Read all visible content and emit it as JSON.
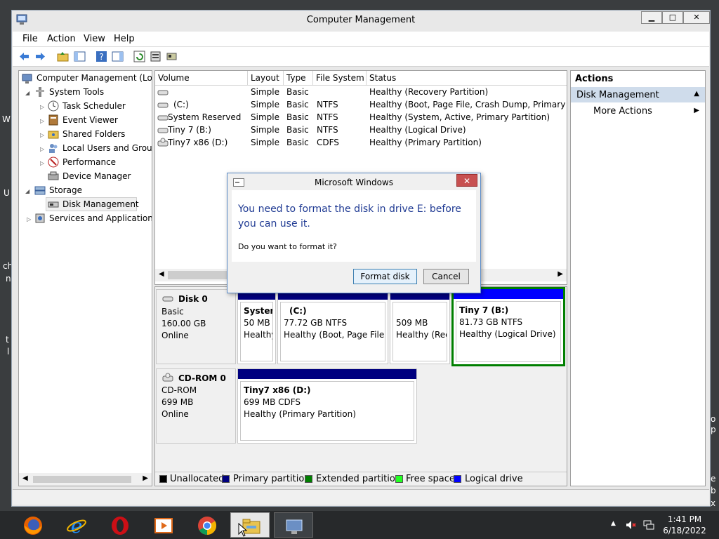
{
  "window": {
    "title": "Computer Management"
  },
  "menu": [
    "File",
    "Action",
    "View",
    "Help"
  ],
  "tree": {
    "root": "Computer Management (Local",
    "system_tools": "System Tools",
    "task_scheduler": "Task Scheduler",
    "event_viewer": "Event Viewer",
    "shared_folders": "Shared Folders",
    "local_users": "Local Users and Group",
    "performance": "Performance",
    "device_manager": "Device Manager",
    "storage": "Storage",
    "disk_management": "Disk Management",
    "services": "Services and Applications"
  },
  "volume_table": {
    "headers": [
      "Volume",
      "Layout",
      "Type",
      "File System",
      "Status"
    ],
    "rows": [
      {
        "volume": "",
        "layout": "Simple",
        "type": "Basic",
        "fs": "",
        "status": "Healthy (Recovery Partition)"
      },
      {
        "volume": "(C:)",
        "layout": "Simple",
        "type": "Basic",
        "fs": "NTFS",
        "status": "Healthy (Boot, Page File, Crash Dump, Primary P"
      },
      {
        "volume": "System Reserved",
        "layout": "Simple",
        "type": "Basic",
        "fs": "NTFS",
        "status": "Healthy (System, Active, Primary Partition)"
      },
      {
        "volume": "Tiny 7 (B:)",
        "layout": "Simple",
        "type": "Basic",
        "fs": "NTFS",
        "status": "Healthy (Logical Drive)"
      },
      {
        "volume": "Tiny7 x86 (D:)",
        "layout": "Simple",
        "type": "Basic",
        "fs": "CDFS",
        "status": "Healthy (Primary Partition)"
      }
    ]
  },
  "disks": {
    "disk0": {
      "name": "Disk 0",
      "type": "Basic",
      "size": "160.00 GB",
      "state": "Online"
    },
    "cdrom0": {
      "name": "CD-ROM 0",
      "type": "CD-ROM",
      "size": "699 MB",
      "state": "Online"
    }
  },
  "partitions": {
    "p1": {
      "name": "System",
      "size": "50 MB",
      "status": "Healthy"
    },
    "p2": {
      "name": "(C:)",
      "size": "77.72 GB NTFS",
      "status": "Healthy (Boot, Page File,"
    },
    "p3": {
      "size": "509 MB",
      "status": "Healthy (Rec"
    },
    "p4": {
      "name": "Tiny 7  (B:)",
      "size": "81.73 GB NTFS",
      "status": "Healthy (Logical Drive)"
    },
    "cd": {
      "name": "Tiny7 x86  (D:)",
      "size": "699 MB CDFS",
      "status": "Healthy (Primary Partition)"
    }
  },
  "legend": [
    "Unallocated",
    "Primary partition",
    "Extended partition",
    "Free space",
    "Logical drive"
  ],
  "colors": {
    "primary": "#00007f",
    "logical": "#0000ff",
    "extended": "#007f00",
    "free": "#22ff22",
    "unallocated": "#000000",
    "selection": "#007f00",
    "dialog_heading": "#1f3a93"
  },
  "actions": {
    "title": "Actions",
    "section": "Disk Management",
    "more": "More Actions"
  },
  "dialog": {
    "title": "Microsoft Windows",
    "heading": "You need to format the disk in drive E: before you can use it.",
    "question": "Do you want to format it?",
    "format_button": "Format disk",
    "cancel_button": "Cancel"
  },
  "taskbar": {
    "time": "1:41 PM",
    "date": "6/18/2022"
  },
  "desktop_fragments": [
    "W",
    "U",
    "ch",
    "n",
    "t",
    "l",
    "o",
    "p",
    "e",
    "b",
    "x"
  ]
}
